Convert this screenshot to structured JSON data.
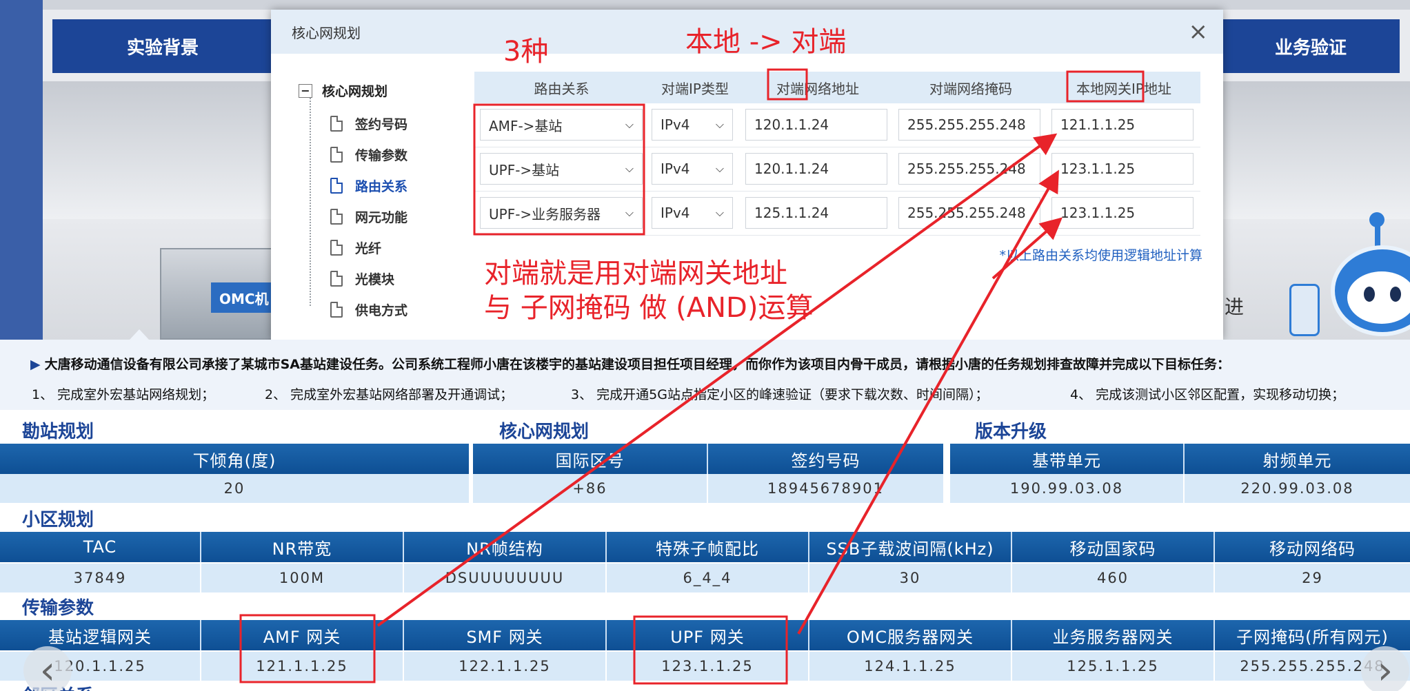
{
  "scene": {
    "nav_left": "实验背景",
    "nav_right": "业务验证",
    "cabinet_label": "OMC机",
    "side_text": "进"
  },
  "modal": {
    "title": "核心网规划",
    "close": "×",
    "tree": {
      "root": "核心网规划",
      "toggle": "−",
      "items": [
        "签约号码",
        "传输参数",
        "路由关系",
        "网元功能",
        "光纤",
        "光模块",
        "供电方式"
      ],
      "active": "路由关系"
    },
    "route_table": {
      "headers": [
        "路由关系",
        "对端IP类型",
        "对端网络地址",
        "对端网络掩码",
        "本地网关IP地址"
      ],
      "rows": [
        {
          "route": "AMF->基站",
          "ip_type": "IPv4",
          "peer_addr": "120.1.1.24",
          "peer_mask": "255.255.255.248",
          "local_gw": "121.1.1.25"
        },
        {
          "route": "UPF->基站",
          "ip_type": "IPv4",
          "peer_addr": "120.1.1.24",
          "peer_mask": "255.255.255.248",
          "local_gw": "123.1.1.25"
        },
        {
          "route": "UPF->业务服务器",
          "ip_type": "IPv4",
          "peer_addr": "125.1.1.24",
          "peer_mask": "255.255.255.248",
          "local_gw": "123.1.1.25"
        }
      ],
      "note": "*以上路由关系均使用逻辑地址计算"
    }
  },
  "task": {
    "intro": "大唐移动通信设备有限公司承接了某城市SA基站建设任务。公司系统工程师小唐在该楼宇的基站建设项目担任项目经理，而你作为该项目内骨干成员，请根据小唐的任务规划排查故障并完成以下目标任务：",
    "items": [
      "1、 完成室外宏基站网络规划；",
      "2、 完成室外宏基站网络部署及开通调试；",
      "3、 完成开通5G站点指定小区的峰速验证（要求下载次数、时间间隔）；",
      "4、 完成该测试小区邻区配置，实现移动切换；"
    ]
  },
  "survey": {
    "title": "勘站规划",
    "headers": [
      "下倾角(度)"
    ],
    "values": [
      "20"
    ]
  },
  "core": {
    "title": "核心网规划",
    "headers": [
      "国际区号",
      "签约号码"
    ],
    "values": [
      "+86",
      "18945678901"
    ]
  },
  "upgrade": {
    "title": "版本升级",
    "headers": [
      "基带单元",
      "射频单元"
    ],
    "values": [
      "190.99.03.08",
      "220.99.03.08"
    ]
  },
  "cell": {
    "title": "小区规划",
    "headers": [
      "TAC",
      "NR带宽",
      "NR帧结构",
      "特殊子帧配比",
      "SSB子载波间隔(kHz)",
      "移动国家码",
      "移动网络码"
    ],
    "values": [
      "37849",
      "100M",
      "DSUUUUUUUU",
      "6_4_4",
      "30",
      "460",
      "29"
    ]
  },
  "transport": {
    "title": "传输参数",
    "headers": [
      "基站逻辑网关",
      "AMF 网关",
      "SMF 网关",
      "UPF 网关",
      "OMC服务器网关",
      "业务服务器网关",
      "子网掩码(所有网元)"
    ],
    "values": [
      "120.1.1.25",
      "121.1.1.25",
      "122.1.1.25",
      "123.1.1.25",
      "124.1.1.25",
      "125.1.1.25",
      "255.255.255.248"
    ]
  },
  "next_section": "邻区关系",
  "pager": {
    "prev": "‹",
    "next": "›"
  },
  "annotations": {
    "three_kinds": "3种",
    "local_to_peer": "本地 -> 对端",
    "explain_line1": "对端就是用对端网关地址",
    "explain_line2": "与 子网掩码 做 (AND)运算"
  },
  "colors": {
    "annotation": "#e8232a",
    "header_blue": "#1c4597",
    "table_head": "#1d66ad",
    "table_body": "#d8e9f8"
  }
}
